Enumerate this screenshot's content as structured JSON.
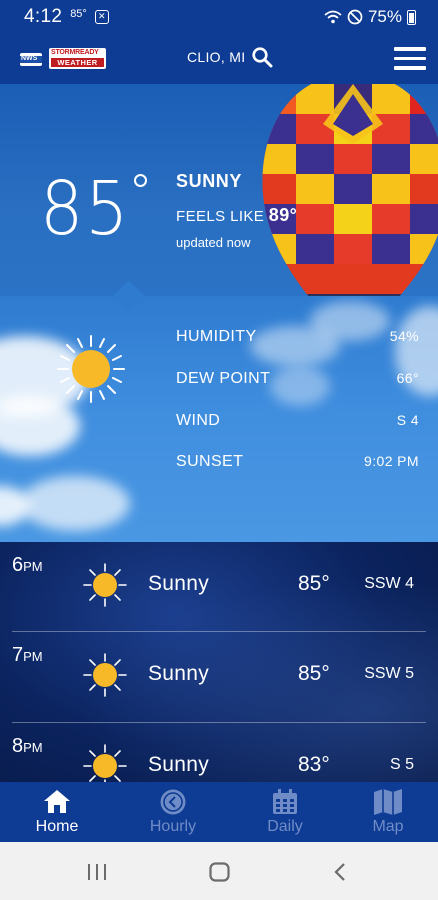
{
  "status_bar": {
    "time": "4:12",
    "temp_small": "85°",
    "notification_glyph": "✕",
    "battery": "75%"
  },
  "header": {
    "logo_nws": "NWS",
    "logo_storm_ready": "STORMREADY",
    "logo_weather": "WEATHER",
    "location": "CLIO, MI"
  },
  "current": {
    "temperature": "85",
    "condition": "SUNNY",
    "feels_like_label": "FEELS LIKE",
    "feels_like_value": "89°",
    "updated": "updated now"
  },
  "details": [
    {
      "label": "HUMIDITY",
      "value": "54%"
    },
    {
      "label": "DEW POINT",
      "value": "66°"
    },
    {
      "label": "WIND",
      "value": "S 4"
    },
    {
      "label": "SUNSET",
      "value": "9:02 PM"
    }
  ],
  "hourly": [
    {
      "hour": "6",
      "ampm": "PM",
      "condition": "Sunny",
      "temp": "85°",
      "wind": "SSW 4"
    },
    {
      "hour": "7",
      "ampm": "PM",
      "condition": "Sunny",
      "temp": "85°",
      "wind": "SSW 5"
    },
    {
      "hour": "8",
      "ampm": "PM",
      "condition": "Sunny",
      "temp": "83°",
      "wind": "S 5"
    }
  ],
  "nav": {
    "home": "Home",
    "hourly": "Hourly",
    "daily": "Daily",
    "map": "Map"
  },
  "colors": {
    "brand_blue": "#0e3b93",
    "sun_yellow": "#f7b928",
    "inactive_nav": "#6f8cc7"
  },
  "icons": [
    "search-icon",
    "menu-icon",
    "sun-icon",
    "home-icon",
    "clock-icon",
    "calendar-icon",
    "map-icon",
    "wifi-icon",
    "battery-icon"
  ]
}
